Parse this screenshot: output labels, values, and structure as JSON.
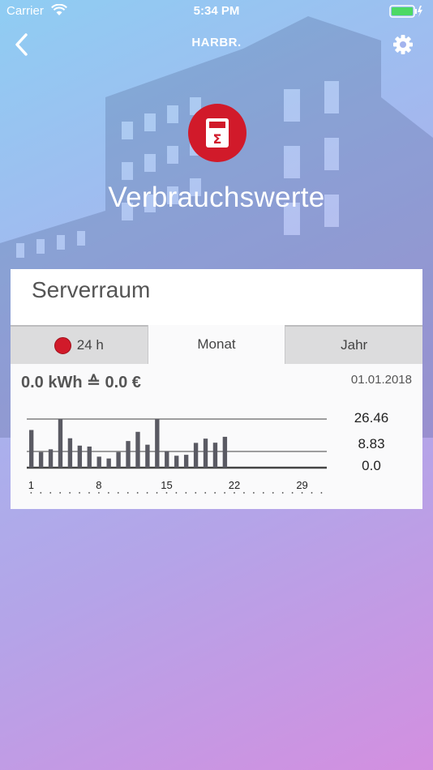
{
  "status_bar": {
    "carrier": "Carrier",
    "time": "5:34 PM"
  },
  "nav": {
    "title": "HARBR."
  },
  "page": {
    "title": "Verbrauchswerte"
  },
  "card": {
    "room": "Serverraum",
    "tabs": [
      {
        "label": "24 h",
        "indicator": "red-dot"
      },
      {
        "label": "Monat",
        "active": true
      },
      {
        "label": "Jahr"
      }
    ],
    "summary": "0.0 kWh ≙ 0.0 €",
    "date": "01.01.2018"
  },
  "colors": {
    "accent_red": "#d11a2a",
    "bar": "#5a5a63",
    "text": "#555555"
  },
  "chart_data": {
    "type": "bar",
    "categories": [
      1,
      2,
      3,
      4,
      5,
      6,
      7,
      8,
      9,
      10,
      11,
      12,
      13,
      14,
      15,
      16,
      17,
      18,
      19,
      20,
      21,
      22,
      23,
      24,
      25,
      26,
      27,
      28,
      29,
      30,
      31
    ],
    "values": [
      20.5,
      8.5,
      10,
      26.46,
      16,
      12,
      11.5,
      6,
      5,
      8.5,
      14.5,
      19.5,
      12.5,
      26.46,
      9,
      6.5,
      7,
      13.5,
      15.8,
      13.6,
      16.8,
      0,
      0,
      0,
      0,
      0,
      0,
      0,
      0,
      0,
      0
    ],
    "tick_labels": [
      "1",
      "8",
      "15",
      "22",
      "29"
    ],
    "y_tick_labels": [
      "26.46",
      "8.83",
      "0.0"
    ],
    "ylim": [
      0,
      26.46
    ],
    "grid": true
  }
}
